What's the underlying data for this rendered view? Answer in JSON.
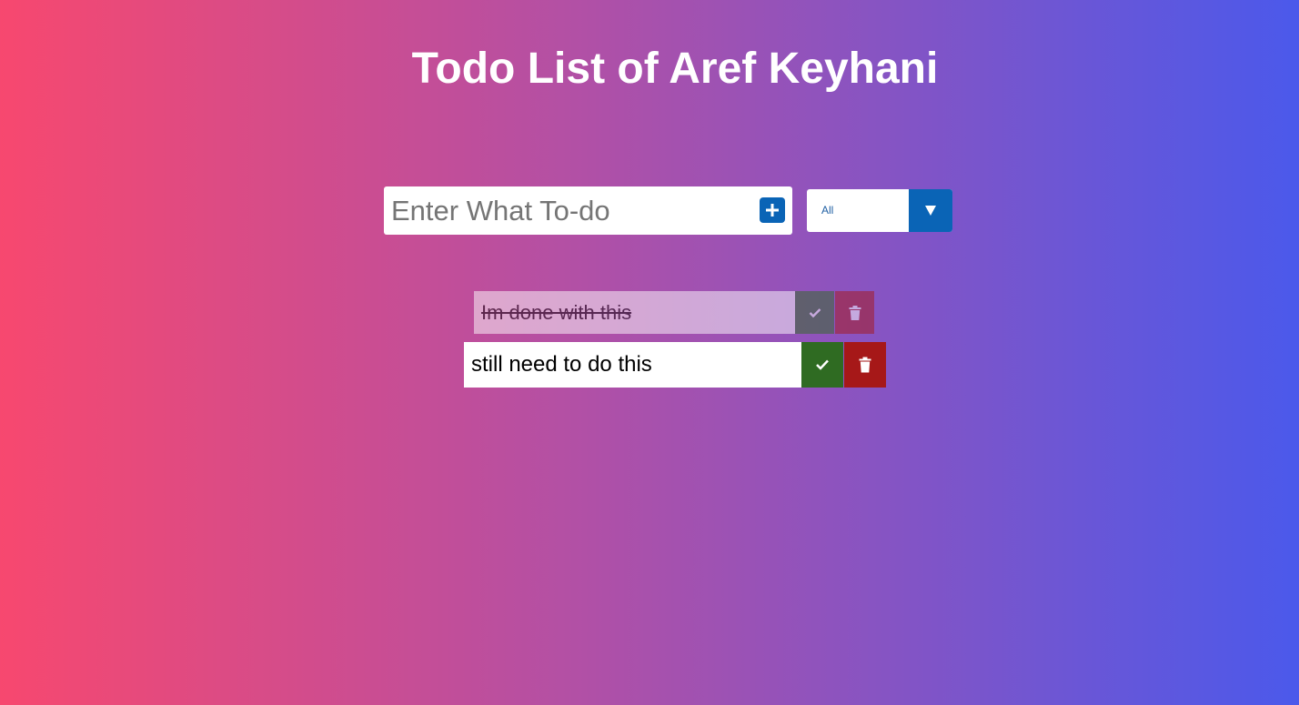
{
  "header": {
    "title": "Todo List of Aref Keyhani"
  },
  "form": {
    "input_placeholder": "Enter What To-do",
    "input_value": "",
    "add_icon": "plus-square-icon",
    "filter_selected": "All",
    "filter_arrow_icon": "caret-down-icon"
  },
  "todos": [
    {
      "text": "Im done with this",
      "completed": true,
      "complete_icon": "check-icon",
      "delete_icon": "trash-icon"
    },
    {
      "text": "still need to do this",
      "completed": false,
      "complete_icon": "check-icon",
      "delete_icon": "trash-icon"
    }
  ],
  "colors": {
    "gradient_start": "#f7486f",
    "gradient_end": "#4b59eb",
    "accent_blue": "#0a64b6",
    "complete_green": "#2f6b22",
    "delete_red": "#a61818"
  }
}
